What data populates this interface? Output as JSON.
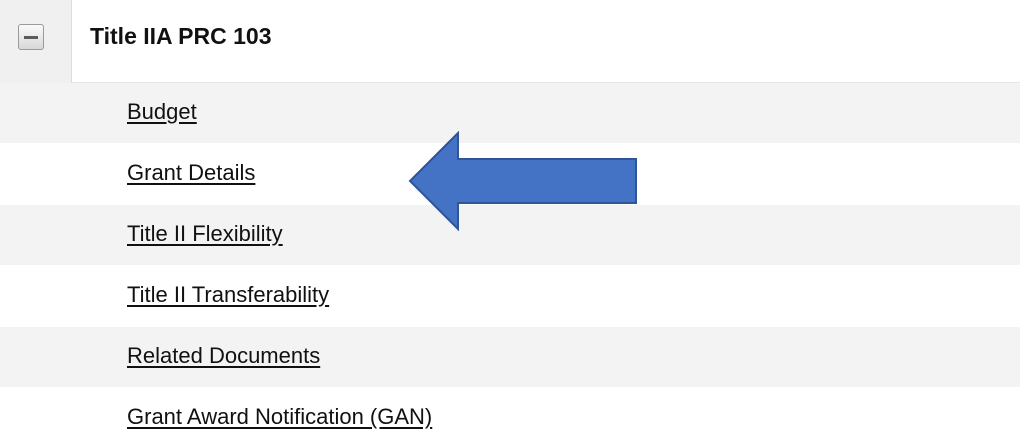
{
  "section": {
    "title": "Title IIA PRC 103",
    "toggle_icon": "collapse-minus-icon"
  },
  "links": [
    {
      "label": "Budget"
    },
    {
      "label": "Grant Details"
    },
    {
      "label": "Title II Flexibility"
    },
    {
      "label": "Title II Transferability"
    },
    {
      "label": "Related Documents"
    },
    {
      "label": "Grant Award Notification (GAN)"
    }
  ],
  "annotation": {
    "icon": "arrow-left-icon",
    "color": "#4472c4"
  },
  "colors": {
    "row_alt": "#f3f3f3",
    "row_plain": "#ffffff",
    "link_text": "#111111"
  }
}
